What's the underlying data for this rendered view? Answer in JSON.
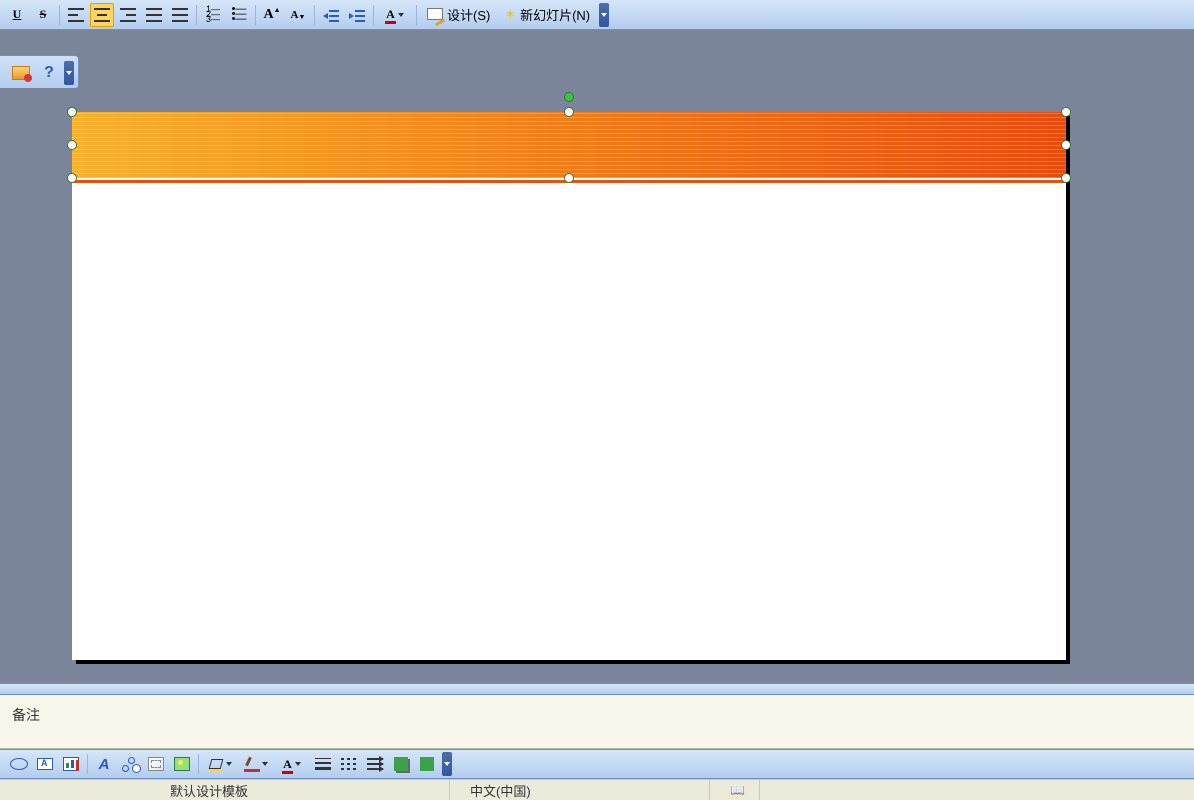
{
  "toolbar": {
    "underline_glyph": "U",
    "strike_glyph": "S",
    "font_grow_glyph": "A",
    "font_shrink_glyph": "A",
    "font_color_glyph": "A",
    "design_label": "设计(S)",
    "new_slide_label": "新幻灯片(N)"
  },
  "help": {
    "question_glyph": "?"
  },
  "notes": {
    "placeholder": "备注"
  },
  "draw": {
    "font_color_glyph": "A",
    "wordart_glyph": "A"
  },
  "status": {
    "template_label": "默认设计模板",
    "language_label": "中文(中国)",
    "spell_glyph": "✓"
  }
}
